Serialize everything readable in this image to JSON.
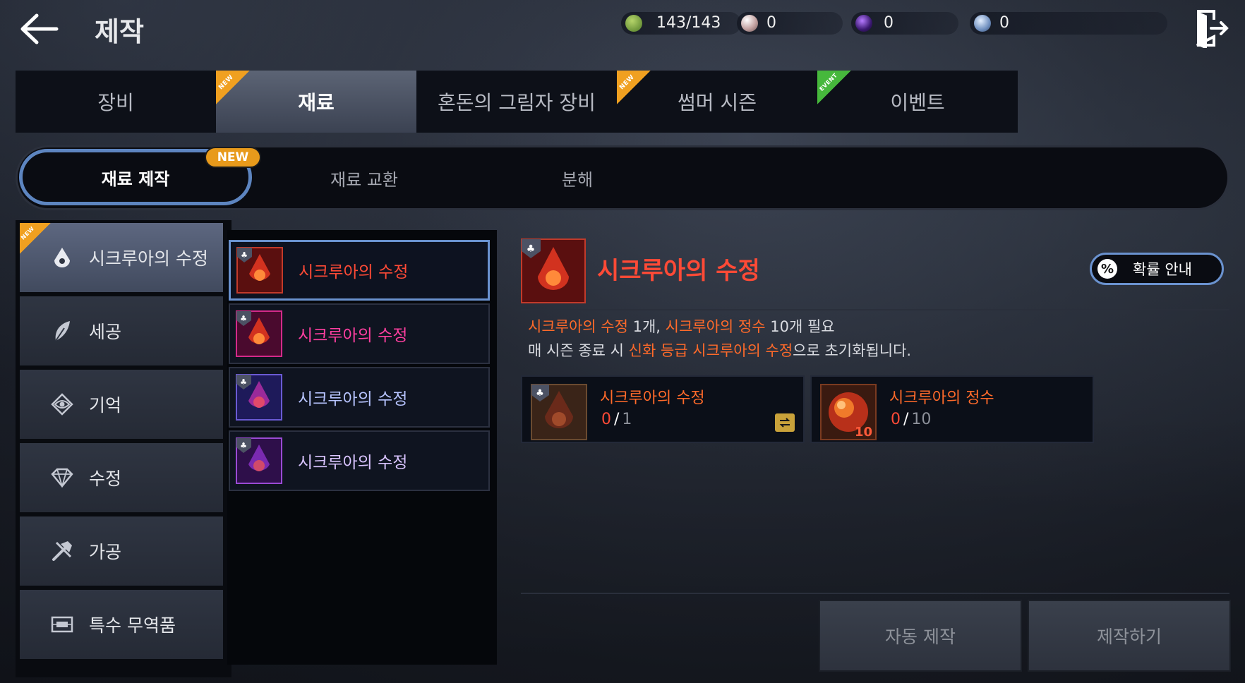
{
  "header": {
    "title": "제작",
    "currencies": [
      {
        "icon": "leaf-coin-icon",
        "value": "143/143",
        "color": "#6b9d3a"
      },
      {
        "icon": "pearl-icon",
        "value": "0",
        "color": "#d9c7c7"
      },
      {
        "icon": "purple-orb-icon",
        "value": "0",
        "color": "#6a2fb0"
      },
      {
        "icon": "silver-coin-icon",
        "value": "0",
        "color": "#9fb6d6"
      }
    ]
  },
  "main_tabs": [
    {
      "label": "장비",
      "badge": ""
    },
    {
      "label": "재료",
      "badge": "NEW",
      "active": true
    },
    {
      "label": "혼돈의 그림자 장비",
      "badge": ""
    },
    {
      "label": "썸머 시즌",
      "badge": "NEW"
    },
    {
      "label": "이벤트",
      "badge": "EVENT"
    }
  ],
  "sub_tabs": [
    {
      "label": "재료 제작",
      "badge": "NEW",
      "active": true
    },
    {
      "label": "재료 교환"
    },
    {
      "label": "분해"
    }
  ],
  "categories": [
    {
      "label": "시크루아의 수정",
      "icon": "crystal-drop-icon",
      "badge": "NEW",
      "active": true
    },
    {
      "label": "세공",
      "icon": "feather-icon"
    },
    {
      "label": "기억",
      "icon": "eye-gem-icon"
    },
    {
      "label": "수정",
      "icon": "diamond-icon"
    },
    {
      "label": "가공",
      "icon": "hammer-icon"
    },
    {
      "label": "특수 무역품",
      "icon": "chest-icon"
    }
  ],
  "recipes": [
    {
      "label": "시크루아의 수정",
      "color": "#ff4a36",
      "frame": "#8a1a1a"
    },
    {
      "label": "시크루아의 수정",
      "color": "#ff3fa0",
      "frame": "#a01a5a"
    },
    {
      "label": "시크루아의 수정",
      "color": "#b7c4ff",
      "frame": "#4a2aa0"
    },
    {
      "label": "시크루아의 수정",
      "color": "#d9c4ff",
      "frame": "#6a2aa0"
    }
  ],
  "detail": {
    "name": "시크루아의 수정",
    "prob_button": "확률 안내",
    "prob_icon": "%",
    "desc_line1": {
      "a": "시크루아의 수정",
      "b": " 1개, ",
      "c": "시크루아의 정수",
      "d": " 10개 필요"
    },
    "desc_line2": {
      "a": "매 시즌 종료 시 ",
      "b": "신화 등급 시크루아의 수정",
      "c": "으로 초기화됩니다."
    },
    "materials": [
      {
        "name": "시크루아의 수정",
        "have": "0",
        "need": "1"
      },
      {
        "name": "시크루아의 정수",
        "have": "0",
        "need": "10",
        "qty_badge": "10"
      }
    ],
    "auto_craft": "자동 제작",
    "craft": "제작하기"
  }
}
